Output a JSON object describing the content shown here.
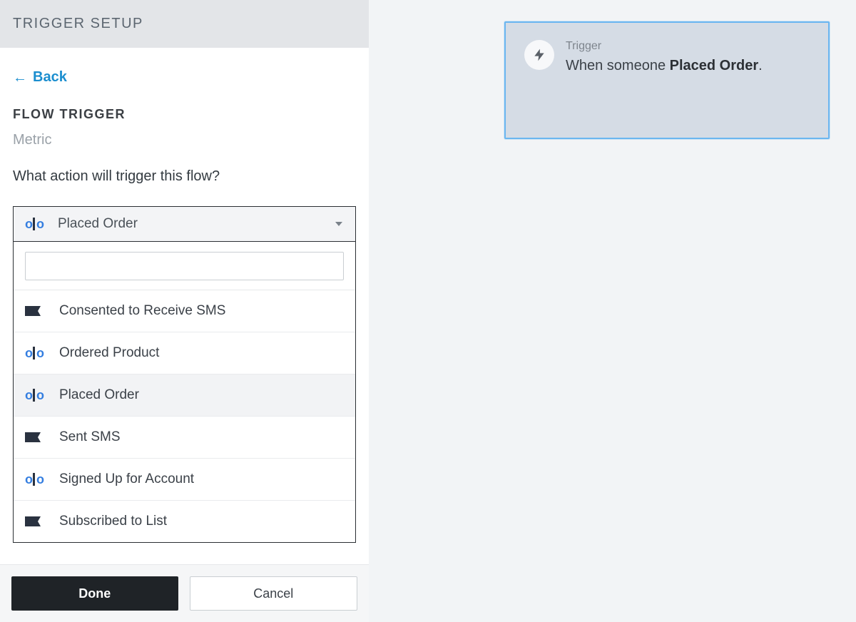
{
  "sidebar": {
    "title": "TRIGGER SETUP",
    "back_label": "Back",
    "section_label": "FLOW TRIGGER",
    "metric_label": "Metric",
    "prompt": "What action will trigger this flow?",
    "selected_option": "Placed Order",
    "search_value": "",
    "options": [
      {
        "icon": "flag",
        "label": "Consented to Receive SMS",
        "selected": false
      },
      {
        "icon": "olo",
        "label": "Ordered Product",
        "selected": false
      },
      {
        "icon": "olo",
        "label": "Placed Order",
        "selected": true
      },
      {
        "icon": "flag",
        "label": "Sent SMS",
        "selected": false
      },
      {
        "icon": "olo",
        "label": "Signed Up for Account",
        "selected": false
      },
      {
        "icon": "flag",
        "label": "Subscribed to List",
        "selected": false
      }
    ],
    "done_label": "Done",
    "cancel_label": "Cancel"
  },
  "card": {
    "label": "Trigger",
    "prefix": "When someone ",
    "event": "Placed Order",
    "suffix": "."
  }
}
